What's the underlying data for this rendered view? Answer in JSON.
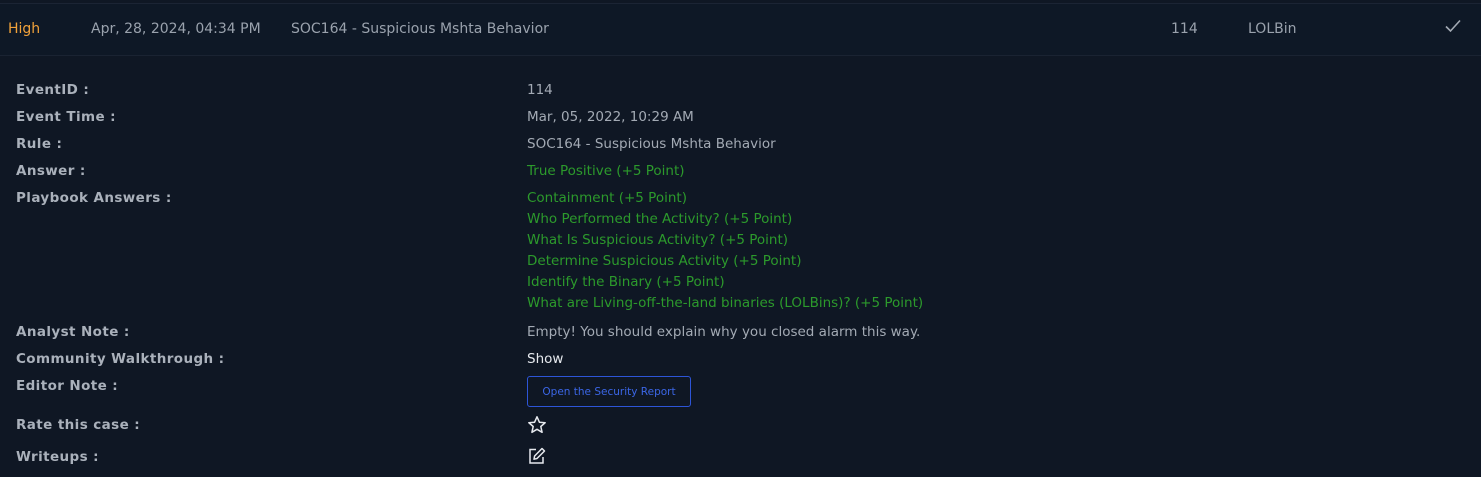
{
  "summary": {
    "severity": "High",
    "date": "Apr, 28, 2024, 04:34 PM",
    "rule": "SOC164 - Suspicious Mshta Behavior",
    "event_id": "114",
    "type": "LOLBin",
    "status_icon": "checkmark-icon"
  },
  "details": {
    "event_id_label": "EventID :",
    "event_id_value": "114",
    "event_time_label": "Event Time :",
    "event_time_value": "Mar, 05, 2022, 10:29 AM",
    "rule_label": "Rule :",
    "rule_value": "SOC164 - Suspicious Mshta Behavior",
    "answer_label": "Answer :",
    "answer_value": "True Positive (+5 Point)",
    "playbook_label": "Playbook Answers :",
    "playbook_answers": [
      "Containment (+5 Point)",
      "Who Performed the Activity? (+5 Point)",
      "What Is Suspicious Activity? (+5 Point)",
      "Determine Suspicious Activity (+5 Point)",
      "Identify the Binary (+5 Point)",
      "What are Living-off-the-land binaries (LOLBins)? (+5 Point)"
    ],
    "analyst_note_label": "Analyst Note :",
    "analyst_note_value": "Empty! You should explain why you closed alarm this way.",
    "community_label": "Community Walkthrough :",
    "community_value": "Show",
    "editor_note_label": "Editor Note :",
    "editor_note_button": "Open the Security Report",
    "rate_label": "Rate this case :",
    "rate_icon": "star-icon",
    "writeups_label": "Writeups :",
    "writeups_icon": "edit-icon"
  },
  "colors": {
    "severity_high": "#f0a13a",
    "answer_green": "#2c9a2c",
    "button_blue": "#2d55d8",
    "background": "#0f1724"
  }
}
